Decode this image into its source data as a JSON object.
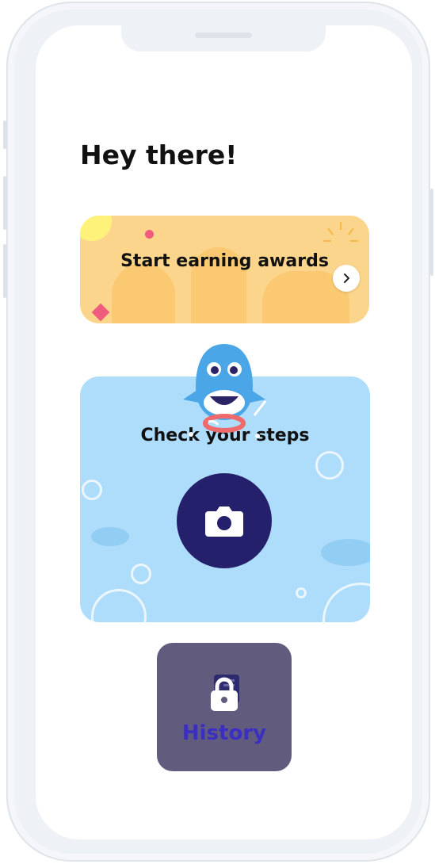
{
  "greeting": "Hey there!",
  "cards": {
    "awards": {
      "title": "Start earning awards",
      "icon": "chevron-right-icon",
      "bg_color": "#fbd58b"
    },
    "steps": {
      "title": "Check your steps",
      "icon": "camera-icon",
      "bg_color": "#aedcfb",
      "button_color": "#25206b"
    }
  },
  "history": {
    "label": "History",
    "icon": "lock-icon",
    "bg_color": "#615b7e",
    "locked": true
  }
}
